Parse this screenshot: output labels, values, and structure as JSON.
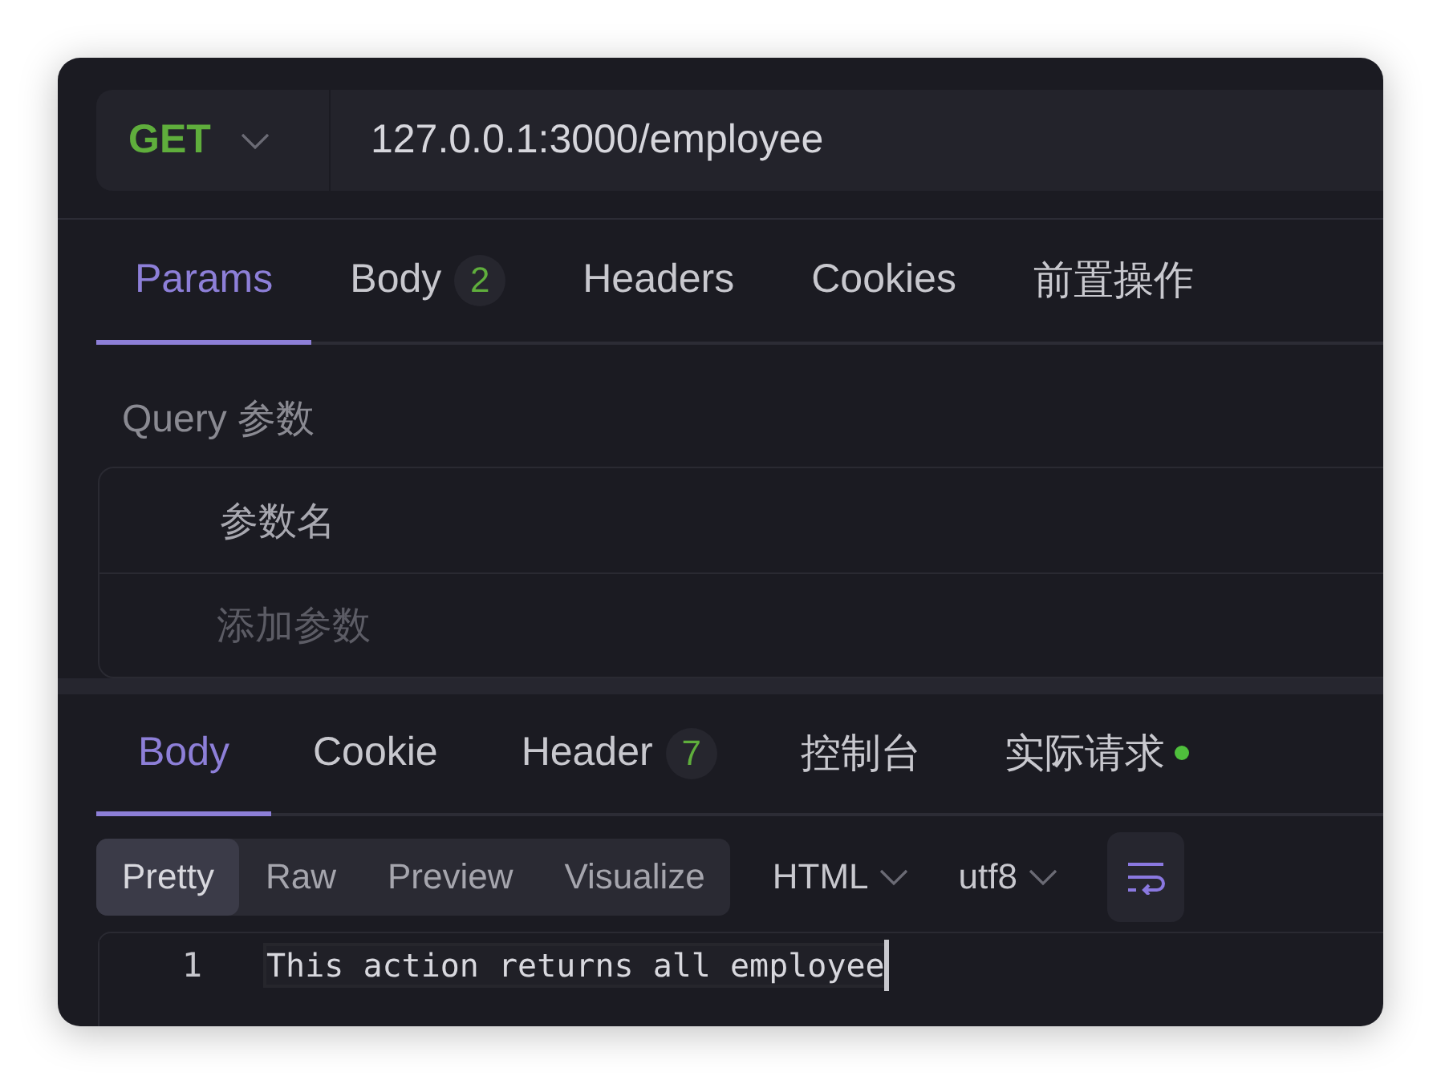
{
  "request": {
    "method": "GET",
    "url": "127.0.0.1:3000/employee"
  },
  "request_tabs": [
    {
      "label": "Params",
      "selected": true
    },
    {
      "label": "Body",
      "badge": "2",
      "selected": false
    },
    {
      "label": "Headers",
      "selected": false
    },
    {
      "label": "Cookies",
      "selected": false
    },
    {
      "label": "前置操作",
      "selected": false
    }
  ],
  "query": {
    "title": "Query 参数",
    "columns": [
      "参数名"
    ],
    "placeholder": "添加参数"
  },
  "response_tabs": [
    {
      "label": "Body",
      "selected": true
    },
    {
      "label": "Cookie",
      "selected": false
    },
    {
      "label": "Header",
      "badge": "7",
      "selected": false
    },
    {
      "label": "控制台",
      "selected": false
    },
    {
      "label": "实际请求",
      "dot": true,
      "selected": false
    }
  ],
  "view_modes": [
    {
      "label": "Pretty",
      "selected": true
    },
    {
      "label": "Raw",
      "selected": false
    },
    {
      "label": "Preview",
      "selected": false
    },
    {
      "label": "Visualize",
      "selected": false
    }
  ],
  "format": "HTML",
  "encoding": "utf8",
  "editor": {
    "lines": [
      {
        "number": "1",
        "text": "This action returns all employee"
      }
    ]
  }
}
